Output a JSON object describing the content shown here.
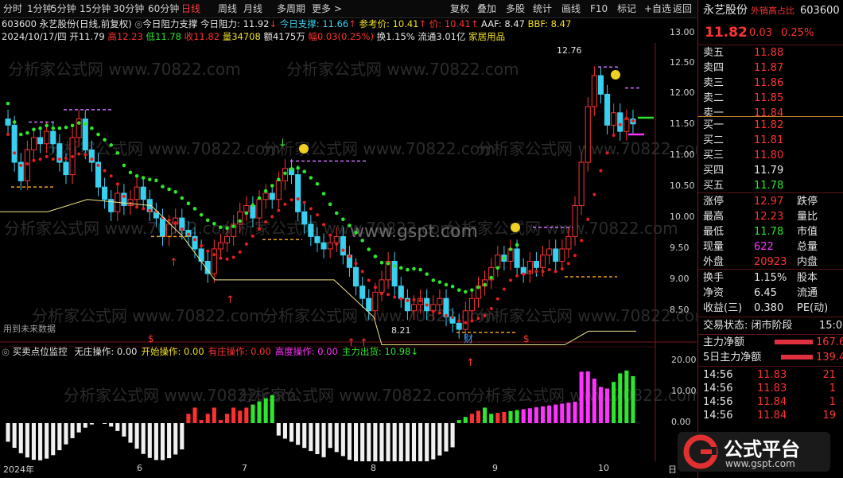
{
  "toolbar": {
    "left": [
      "分时",
      "1分钟",
      "5分钟",
      "15分钟",
      "30分钟",
      "60分钟",
      "日线",
      "周线",
      "月线",
      "多周期",
      "更多 >"
    ],
    "active_index": 6,
    "right": [
      "复权",
      "叠加",
      "多股",
      "统计",
      "画线",
      "F10",
      "标记",
      "+自选",
      "返回"
    ]
  },
  "info": {
    "code_title": "603600 永艺股份(日线,前复权)",
    "indicator_name": "今日阻力支撑",
    "resist_label": "今日阻力: 11.92",
    "support_label": "今日支撑: 11.66",
    "ref_label": "参考价: 10.41",
    "ref_price": "价: 10.41",
    "aaf": "AAF: 8.47",
    "bbf": "BBF: 8.47",
    "date": "2024/10/17/四",
    "open": "开11.79",
    "high": "高12.23",
    "low": "低11.78",
    "close": "收11.82",
    "vol": "量34708",
    "amount": "额4175万",
    "amp": "幅0.03(0.25%)",
    "turnover": "换1.15%",
    "float": "流通3.01亿",
    "industry": "家居用品"
  },
  "main_chart": {
    "price_axis": [
      "13.00",
      "12.50",
      "12.00",
      "11.50",
      "11.00",
      "10.50",
      "10.00",
      "9.50",
      "9.00",
      "8.50"
    ],
    "high_label": "12.76",
    "low_label": "8.21",
    "future_note": "用到未来数据",
    "watermark": "分析家公式网 www.70822.com",
    "site_watermark": "www.gspt.com",
    "markers": {
      "s": "$",
      "cai": "财"
    }
  },
  "sub_chart": {
    "title": "买卖点位监控",
    "items": [
      {
        "label": "无庄操作: 0.00",
        "color": "#e6e6e6"
      },
      {
        "label": "开始操作: 0.00",
        "color": "#f0e020"
      },
      {
        "label": "有庄操作: 0.00",
        "color": "#ff3333"
      },
      {
        "label": "高度操作: 0.00",
        "color": "#ff33ff"
      },
      {
        "label": "主力出货: 10.98",
        "color": "#2ee62e"
      }
    ],
    "axis": [
      "20.00",
      "10.00",
      "0.00"
    ]
  },
  "bottom_axis": {
    "labels": [
      "2024年",
      "6",
      "7",
      "8",
      "9",
      "10",
      "日"
    ]
  },
  "quote": {
    "name": "永艺股份",
    "tag": "外销高占比",
    "code": "603600",
    "price": "11.82",
    "change": "0.03",
    "pct": "0.25%",
    "asks": [
      {
        "label": "卖五",
        "price": "11.88"
      },
      {
        "label": "卖四",
        "price": "11.87"
      },
      {
        "label": "卖三",
        "price": "11.86"
      },
      {
        "label": "卖二",
        "price": "11.85"
      },
      {
        "label": "卖一",
        "price": "11.84"
      }
    ],
    "bids": [
      {
        "label": "买一",
        "price": "11.82"
      },
      {
        "label": "买二",
        "price": "11.81"
      },
      {
        "label": "买三",
        "price": "11.80"
      },
      {
        "label": "买四",
        "price": "11.79"
      },
      {
        "label": "买五",
        "price": "11.78"
      }
    ],
    "stats": [
      {
        "l": "涨停",
        "v": "12.97",
        "v_color": "#ff3333",
        "r": "跌停"
      },
      {
        "l": "最高",
        "v": "12.23",
        "v_color": "#ff3333",
        "r": "量比"
      },
      {
        "l": "最低",
        "v": "11.78",
        "v_color": "#2ee62e",
        "r": "市值"
      },
      {
        "l": "现量",
        "v": "622",
        "v_color": "#ff33ff",
        "r": "总量"
      },
      {
        "l": "外盘",
        "v": "20923",
        "v_color": "#ff3333",
        "r": "内盘"
      }
    ],
    "fund": [
      {
        "l": "换手",
        "v": "1.15%",
        "r": "股本"
      },
      {
        "l": "净资",
        "v": "6.45",
        "r": "流通"
      },
      {
        "l": "收益(三)",
        "v": "0.380",
        "r": "PE(动)"
      }
    ],
    "state": "交易状态: 闭市阶段",
    "state_time": "15:0",
    "main_net": "主力净额",
    "main_net_val": "167.6",
    "main_net5": "5日主力净额",
    "main_net5_val": "139.4",
    "ticks": [
      {
        "t": "14:56",
        "p": "11.83",
        "v": "21",
        "pc": "#ff3333",
        "vc": "#ff3333"
      },
      {
        "t": "14:56",
        "p": "11.83",
        "v": "1",
        "pc": "#ff3333",
        "vc": "#ff3333"
      },
      {
        "t": "14:56",
        "p": "11.84",
        "v": "1",
        "pc": "#ff3333",
        "vc": "#ff3333"
      },
      {
        "t": "14:56",
        "p": "11.84",
        "v": "19",
        "pc": "#ff3333",
        "vc": "#ff3333"
      }
    ]
  },
  "logo": {
    "text": "公式平台",
    "url": "www.gspt.com"
  }
}
